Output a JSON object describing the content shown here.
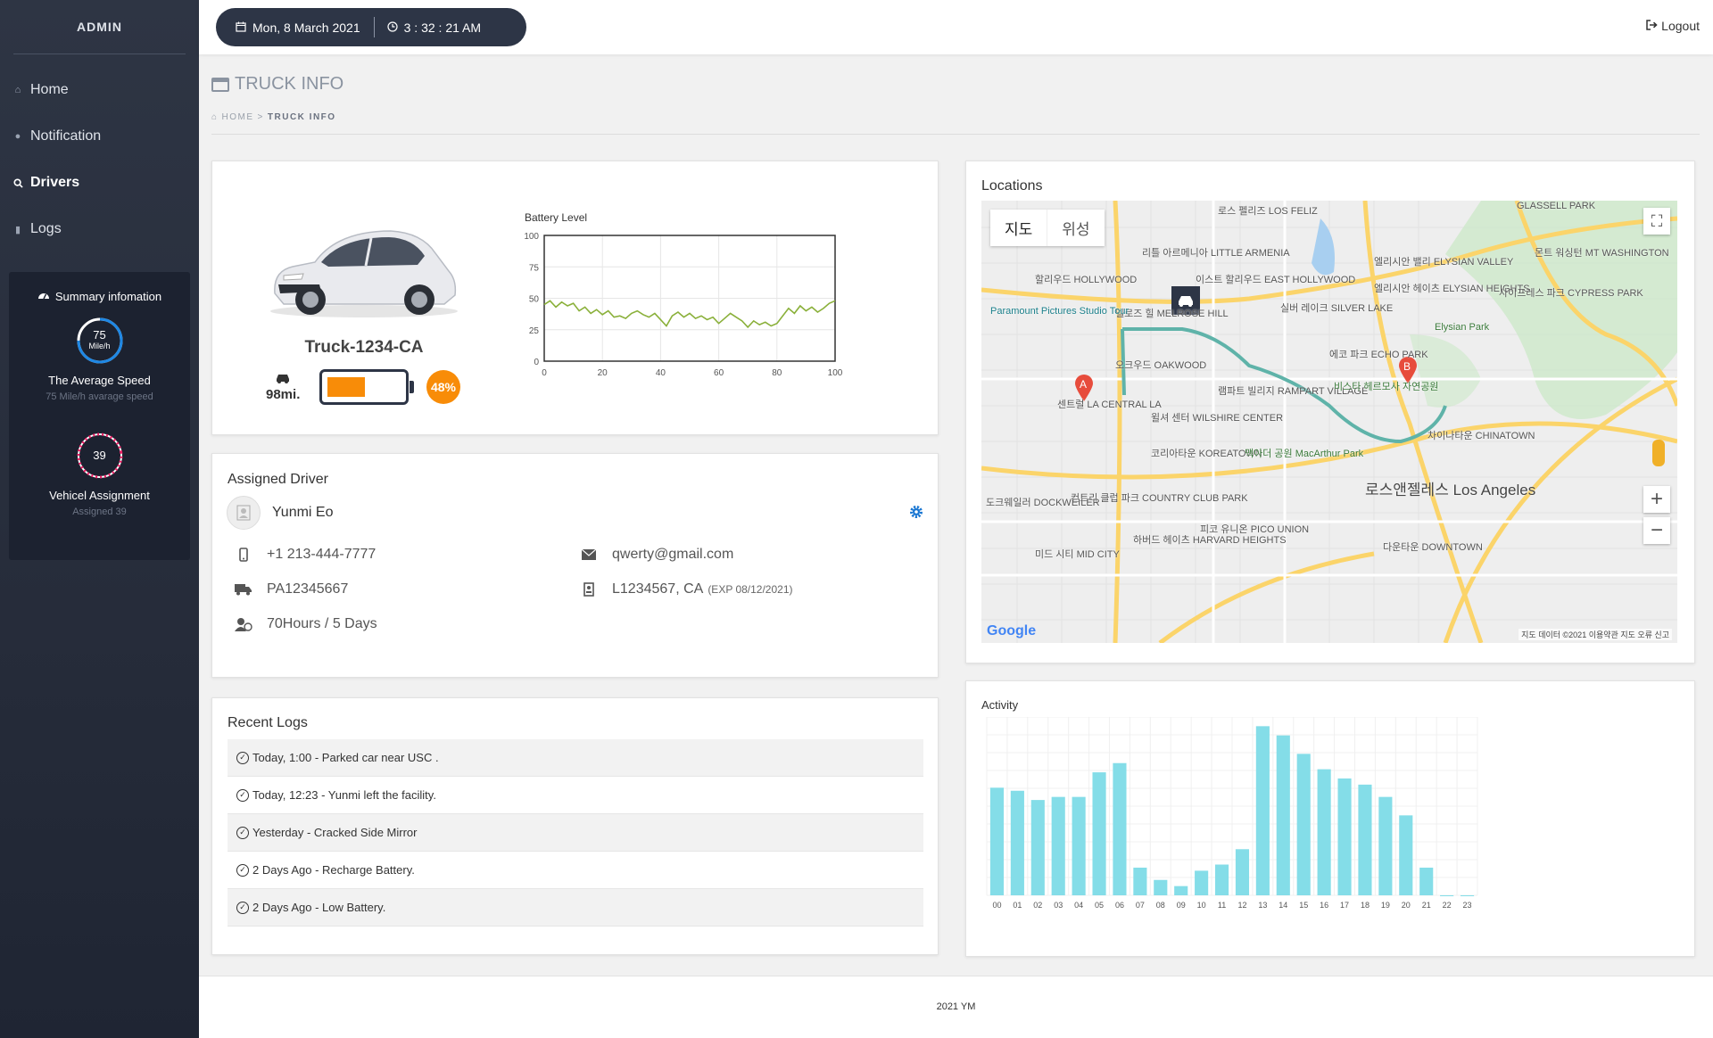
{
  "sidebar": {
    "brand": "ADMIN",
    "items": [
      {
        "label": "Home",
        "active": false
      },
      {
        "label": "Notification",
        "active": false
      },
      {
        "label": "Drivers",
        "active": true
      },
      {
        "label": "Logs",
        "active": false
      }
    ],
    "summary": {
      "title": "Summary infomation",
      "speed": {
        "value": "75",
        "unit": "Mile/h",
        "title": "The Average Speed",
        "sub": "75 Mile/h avarage speed",
        "fraction": 0.75,
        "color": "#1e88e5"
      },
      "assignment": {
        "value": "39",
        "title": "Vehicel Assignment",
        "sub": "Assigned 39",
        "fraction": 0.39,
        "color": "#e91e63"
      }
    }
  },
  "topbar": {
    "date": "Mon, 8 March 2021",
    "time": "3 : 32 : 21 AM",
    "logout": "Logout"
  },
  "page": {
    "title": "TRUCK INFO",
    "breadcrumb_home": "HOME",
    "breadcrumb_sep": ">",
    "breadcrumb_current": "TRUCK INFO"
  },
  "truck": {
    "name": "Truck-1234-CA",
    "miles": "98mi.",
    "battery_fraction": 0.48,
    "battery_label": "48%",
    "accent": "#f88c08"
  },
  "battery_chart": {
    "chart_data": {
      "type": "line",
      "title": "Battery Level",
      "xlim": [
        0,
        100
      ],
      "ylim": [
        0,
        100
      ],
      "xticks": [
        0,
        20,
        40,
        60,
        80,
        100
      ],
      "yticks": [
        0,
        25,
        50,
        75,
        100
      ],
      "color": "#8ab03a",
      "x": [
        0,
        2,
        4,
        6,
        8,
        10,
        12,
        14,
        16,
        18,
        20,
        22,
        24,
        26,
        28,
        30,
        32,
        34,
        36,
        38,
        40,
        42,
        44,
        46,
        48,
        50,
        52,
        54,
        56,
        58,
        60,
        62,
        64,
        66,
        68,
        70,
        72,
        74,
        76,
        78,
        80,
        82,
        84,
        86,
        88,
        90,
        92,
        94,
        96,
        98,
        100
      ],
      "y": [
        45,
        48,
        43,
        47,
        44,
        46,
        40,
        43,
        38,
        41,
        37,
        40,
        35,
        36,
        34,
        38,
        40,
        37,
        35,
        38,
        33,
        28,
        36,
        39,
        35,
        38,
        34,
        36,
        33,
        35,
        30,
        34,
        38,
        35,
        32,
        27,
        32,
        29,
        31,
        28,
        30,
        36,
        42,
        38,
        44,
        40,
        43,
        39,
        42,
        46,
        48
      ]
    }
  },
  "driver": {
    "section_title": "Assigned Driver",
    "name": "Yunmi Eo",
    "phone": "+1 213-444-7777",
    "email": "qwerty@gmail.com",
    "plate": "PA12345667",
    "license": "L1234567, CA",
    "license_exp": "(EXP 08/12/2021)",
    "hours": "70Hours / 5 Days"
  },
  "logs": {
    "section_title": "Recent Logs",
    "items": [
      "Today, 1:00 - Parked car near USC .",
      "Today, 12:23 - Yunmi left the facility.",
      "Yesterday - Cracked Side Mirror",
      "2 Days Ago - Recharge Battery.",
      "2 Days Ago - Low Battery."
    ]
  },
  "locations": {
    "section_title": "Locations",
    "toggle_map": "지도",
    "toggle_satellite": "위성",
    "marker_a": "A",
    "marker_b": "B",
    "footer": "지도 데이터 ©2021   이용약관   지도 오류 신고",
    "google": "Google",
    "labels": [
      "로스 펠리즈 LOS FELIZ",
      "리틀 아르메니아 LITTLE ARMENIA",
      "할리우드 HOLLYWOOD",
      "이스트 할리우드 EAST HOLLYWOOD",
      "멜로즈 힐 MELROSE HILL",
      "실버 레이크 SILVER LAKE",
      "엘리시안 밸리 ELYSIAN VALLEY",
      "엘리시안 헤이츠 ELYSIAN HEIGHTS",
      "Paramount Pictures Studio Tour",
      "Elysian Park",
      "에코 파크 ECHO PARK",
      "오크우드 OAKWOOD",
      "램파트 빌리지 RAMPART VILLAGE",
      "비스타 헤르모사 자연공원",
      "센트럴 LA CENTRAL LA",
      "윌셔 센터 WILSHIRE CENTER",
      "코리아타운 KOREATOWN",
      "맥아더 공원 MacArthur Park",
      "차이나타운 CHINATOWN",
      "로스앤젤레스 Los Angeles",
      "컨트리 클럽 파크 COUNTRY CLUB PARK",
      "피코 유니온 PICO UNION",
      "하버드 헤이츠 HARVARD HEIGHTS",
      "미드 시티 MID CITY",
      "다운타운 DOWNTOWN",
      "GLASSELL PARK",
      "사이프레스 파크 CYPRESS PARK",
      "몬트 워싱턴 MT WASHINGTON",
      "도크웨일러 DOCKWEILER"
    ]
  },
  "activity": {
    "chart_data": {
      "type": "bar",
      "title": "Activity",
      "categories": [
        "00",
        "01",
        "02",
        "03",
        "04",
        "05",
        "06",
        "07",
        "08",
        "09",
        "10",
        "11",
        "12",
        "13",
        "14",
        "15",
        "16",
        "17",
        "18",
        "19",
        "20",
        "21",
        "22",
        "23"
      ],
      "values": [
        47,
        46,
        43,
        44,
        44,
        52,
        55,
        21,
        17,
        15,
        20,
        22,
        27,
        67,
        64,
        58,
        53,
        50,
        48,
        44,
        38,
        21,
        0,
        0
      ],
      "ylim": [
        12,
        70
      ],
      "color": "#84dde8"
    }
  },
  "footer": {
    "text": "2021 YM"
  }
}
